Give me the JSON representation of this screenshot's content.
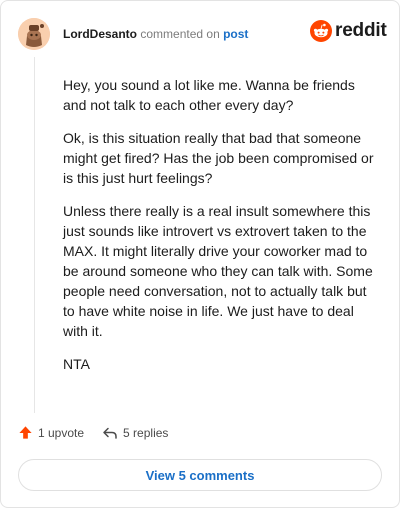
{
  "header": {
    "username": "LordDesanto",
    "action_text": "commented on",
    "post_link": "post",
    "brand_name": "reddit"
  },
  "comment": {
    "paragraphs": [
      "Hey, you sound a lot like me. Wanna be friends and not talk to each other every day?",
      "Ok, is this situation really that bad that someone might get fired? Has the job been compromised or is this just hurt feelings?",
      "Unless there really is a real insult somewhere this just sounds like introvert vs extrovert taken to the MAX. It might literally drive your coworker mad to be around someone who they can talk with. Some people need conversation, not to actually talk but to have white noise in life. We just have to deal with it.",
      "NTA"
    ]
  },
  "actions": {
    "upvote_label": "1 upvote",
    "replies_label": "5 replies"
  },
  "footer": {
    "view_comments_label": "View 5 comments"
  },
  "colors": {
    "reddit_orange": "#ff4500",
    "link_blue": "#1a6fc7",
    "upvote_orange": "#ff4500"
  },
  "icons": {
    "avatar": "snoo-avatar",
    "brand": "reddit-logo-icon",
    "upvote": "upvote-arrow-icon",
    "reply": "reply-arrow-icon"
  }
}
